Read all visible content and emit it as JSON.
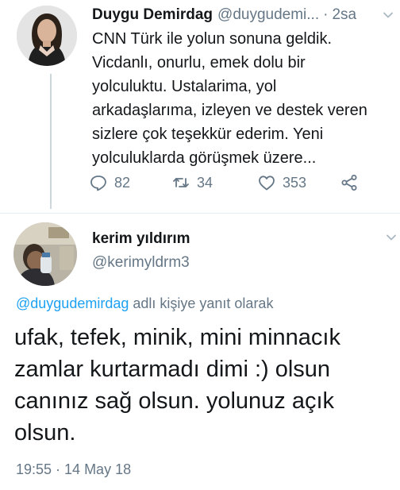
{
  "tweet": {
    "author_name": "Duygu Demirdag",
    "author_handle": "@duygudemi...",
    "separator": "·",
    "time": "2sa",
    "text": "CNN Türk ile yolun sonuna geldik.\nVicdanlı, onurlu, emek dolu bir\nyolculuktu. Ustalarima, yol\narkadaşlarıma, izleyen ve destek veren\nsizlere çok teşekkür ederim. Yeni\nyolculuklarda görüşmek üzere...",
    "replies": "82",
    "retweets": "34",
    "likes": "353"
  },
  "reply": {
    "author_name": "kerim yıldırım",
    "author_handle": "@kerimyldrm3",
    "reply_to_handle": "@duygudemirdag",
    "reply_to_suffix": " adlı kişiye yanıt olarak",
    "text": "ufak, tefek, minik, mini minnacık zamlar kurtarmadı dimi :) olsun canınız sağ olsun. yolunuz açık olsun.",
    "timestamp": "19:55 · 14 May 18"
  },
  "icons": {
    "reply": "reply-icon",
    "retweet": "retweet-icon",
    "like": "heart-icon",
    "share": "share-icon",
    "menu": "chevron-down-icon"
  },
  "colors": {
    "link": "#1da1f2",
    "secondary_text": "#657786",
    "primary_text": "#14171a",
    "thread_line": "#ccd6dd"
  }
}
